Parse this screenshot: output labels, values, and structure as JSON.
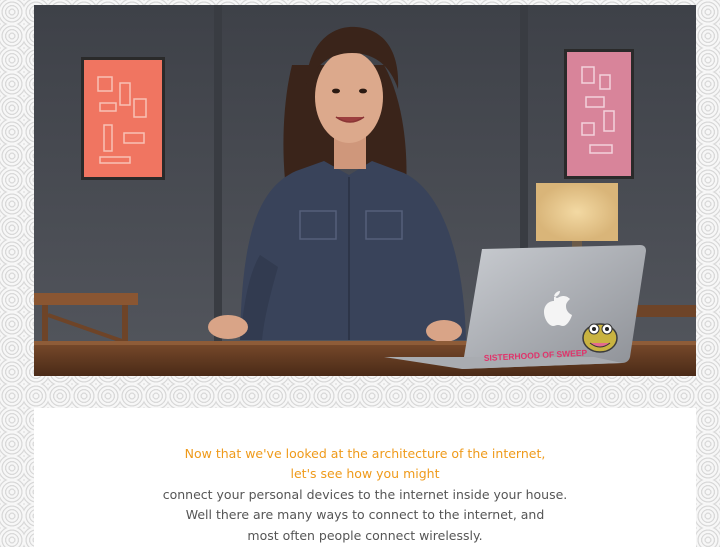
{
  "video": {
    "sticker_text": "SISTERHOOD OF SWEEP"
  },
  "transcript": {
    "lines": [
      {
        "text": "Now that we've looked at the architecture of the internet,",
        "active": true
      },
      {
        "text": "let's see how you might",
        "active": true
      },
      {
        "text": "connect your personal devices to the internet inside your house.",
        "active": false
      },
      {
        "text": "Well there are many ways to connect to the internet, and",
        "active": false
      },
      {
        "text": "most often people connect wirelessly.",
        "active": false
      }
    ]
  },
  "colors": {
    "active_text": "#ef9a1a",
    "inactive_text": "#555555",
    "background_pattern": "#d9d9d9"
  },
  "icons": [
    "apple-logo-icon",
    "frog-sticker-icon"
  ]
}
